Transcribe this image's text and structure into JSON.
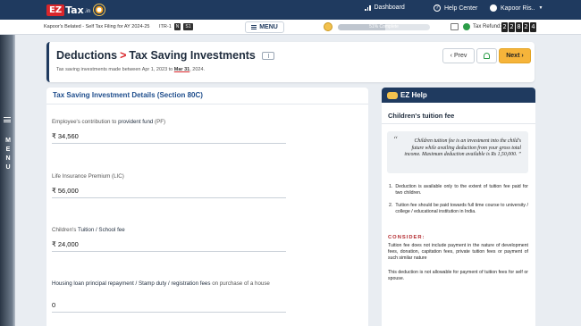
{
  "topbar": {
    "logo_ez": "EZ",
    "logo_tax": "Tax",
    "logo_in": ".in",
    "dashboard": "Dashboard",
    "help_center": "Help Center",
    "user_name": "Kapoor Ris.."
  },
  "subbar": {
    "filing_label": "Kapoor's Belated - Self Tax Filing for AY 2024-25",
    "itr_label": "ITR-1",
    "itr_badge_1": "N",
    "itr_badge_2": "S1",
    "menu_label": "MENU",
    "progress_text": "51% Complete",
    "progress_percent": 51,
    "tax_refund_label": "Tax Refund:",
    "tax_refund_digits": [
      "2",
      "2",
      "8",
      "2",
      "4"
    ]
  },
  "leftbar": {
    "menu_letters": "M E N U"
  },
  "header": {
    "title_part1": "Deductions",
    "chevron": ">",
    "title_part2": "Tax Saving Investments",
    "subtitle_prefix": "Tax saving investments made between Apr 1, 2023 to",
    "subtitle_date": "Mar 31",
    "subtitle_suffix": ", 2024.",
    "prev_label": "Prev",
    "next_label": "Next"
  },
  "main": {
    "section_title": "Tax Saving Investment Details (Section 80C)",
    "fields": [
      {
        "label_plain": "Employee's contribution to ",
        "label_bold": "provident fund",
        "label_tail": " (PF)",
        "value": "₹ 34,560"
      },
      {
        "label_plain": "Life Insurance Premium (LIC)",
        "label_bold": "",
        "label_tail": "",
        "value": "₹ 56,000"
      },
      {
        "label_plain": "Children's ",
        "label_bold": "Tuition / School fee",
        "label_tail": "",
        "value": "₹ 24,000"
      },
      {
        "label_plain": "",
        "label_bold": "Housing loan principal repayment / Stamp duty / registration fees",
        "label_tail": " on purchase of a house",
        "value": "0"
      }
    ]
  },
  "help": {
    "panel_title": "EZ Help",
    "subtitle": "Children's tuition fee",
    "quote_open": "“",
    "quote": "Children tuition fee is an investment into the child's future while availing deduction from your gross total income. Maximum deduction available is Rs 1,50,000. ”",
    "points": [
      {
        "num": "1.",
        "text": "Deduction is available only to the extent of tuition fee paid for two children."
      },
      {
        "num": "2.",
        "text": "Tuition fee should be paid towards full time course to university / college / educational institution in India."
      }
    ],
    "consider_title": "CONSIDER:",
    "consider_1": "Tuition fee does not include payment in the nature of development fees, donation, capitation fees, private tuition fees or payment of such similar nature",
    "consider_2": "This deduction is not allowable for payment of tuition fees for self or spouse."
  },
  "colors": {
    "navy": "#1f3a5f",
    "brand_red": "#d9262b",
    "next_orange": "#f6b43a",
    "section_blue": "#1e4d8c"
  }
}
